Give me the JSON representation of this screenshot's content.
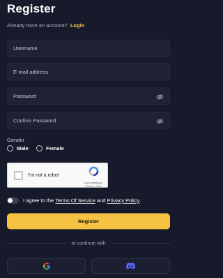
{
  "header": {
    "title": "Register",
    "prompt": "Already have an account?",
    "login_link": "Login"
  },
  "form": {
    "username_placeholder": "Username",
    "email_placeholder": "E-mail address",
    "password_placeholder": "Password",
    "confirm_password_placeholder": "Confirm Password",
    "gender_label": "Gender",
    "gender_options": [
      "Male",
      "Female"
    ]
  },
  "captcha": {
    "label": "I'm not a robot",
    "brand": "reCAPTCHA",
    "links": "Privacy - Terms"
  },
  "terms": {
    "prefix": "I agree to the",
    "terms_link": "Terms Of Service",
    "conjunction": "and",
    "privacy_link": "Privacy Policy",
    "suffix": "."
  },
  "actions": {
    "register_label": "Register",
    "divider_text": "or continue with"
  },
  "social": {
    "google_icon": "google-icon",
    "discord_icon": "discord-icon"
  },
  "colors": {
    "background": "#171a2b",
    "accent": "#f5c341",
    "field_bg": "#1e2234"
  }
}
